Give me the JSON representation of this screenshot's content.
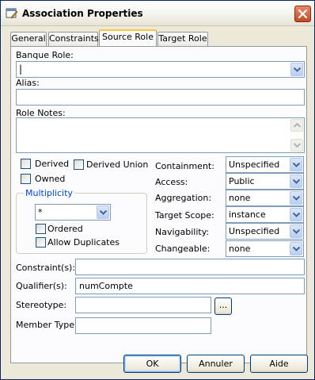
{
  "window": {
    "title": "Association Properties"
  },
  "tabs": [
    {
      "label": "General"
    },
    {
      "label": "Constraints"
    },
    {
      "label": "Source Role"
    },
    {
      "label": "Target Role"
    }
  ],
  "form": {
    "banque_role_label": "Banque Role:",
    "banque_role_value": "",
    "alias_label": "Alias:",
    "alias_value": "",
    "role_notes_label": "Role Notes:",
    "role_notes_value": "",
    "derived_label": "Derived",
    "derived_union_label": "Derived Union",
    "owned_label": "Owned",
    "multiplicity": {
      "title": "Multiplicity",
      "value": "*",
      "ordered_label": "Ordered",
      "allow_duplicates_label": "Allow Duplicates"
    },
    "containment_label": "Containment:",
    "containment_value": "Unspecified",
    "access_label": "Access:",
    "access_value": "Public",
    "aggregation_label": "Aggregation:",
    "aggregation_value": "none",
    "target_scope_label": "Target Scope:",
    "target_scope_value": "instance",
    "navigability_label": "Navigability:",
    "navigability_value": "Unspecified",
    "changeable_label": "Changeable:",
    "changeable_value": "none",
    "constraints_label": "Constraint(s):",
    "constraints_value": "",
    "qualifiers_label": "Qualifier(s):",
    "qualifiers_value": "numCompte",
    "stereotype_label": "Stereotype:",
    "stereotype_value": "",
    "stereotype_browse_label": "...",
    "member_type_label": "Member Type:",
    "member_type_value": ""
  },
  "buttons": {
    "ok": "OK",
    "cancel": "Annuler",
    "help": "Aide"
  }
}
